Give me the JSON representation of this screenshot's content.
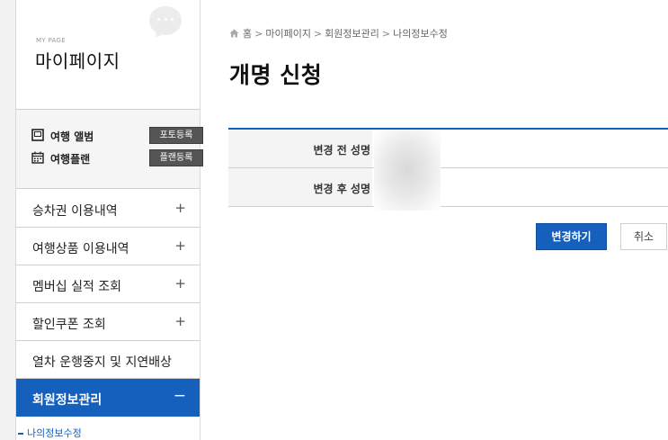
{
  "sidebar": {
    "mypage_caption": "MY PAGE",
    "title": "마이페이지",
    "quick_links": [
      {
        "label": "여행 앨범",
        "button": "포토등록",
        "icon": "album-icon"
      },
      {
        "label": "여행플랜",
        "button": "플랜등록",
        "icon": "calendar-icon"
      }
    ],
    "menu": [
      {
        "label": "승차권 이용내역",
        "sign": "+"
      },
      {
        "label": "여행상품 이용내역",
        "sign": "+"
      },
      {
        "label": "멤버십 실적 조회",
        "sign": "+"
      },
      {
        "label": "할인쿠폰 조회",
        "sign": "+"
      },
      {
        "label": "열차 운행중지 및 지연배상",
        "sign": ""
      },
      {
        "label": "회원정보관리",
        "sign": "−"
      }
    ],
    "submenu": [
      {
        "label": "나의정보수정"
      }
    ]
  },
  "breadcrumb": [
    "홈",
    "마이페이지",
    "회원정보관리",
    "나의정보수정"
  ],
  "page": {
    "title": "개명 신청"
  },
  "form": {
    "rows": [
      {
        "label": "변경 전 성명"
      },
      {
        "label": "변경 후 성명"
      }
    ]
  },
  "actions": {
    "submit": "변경하기",
    "cancel": "취소"
  },
  "colors": {
    "accent": "#1560bd",
    "quick_button": "#555555"
  }
}
